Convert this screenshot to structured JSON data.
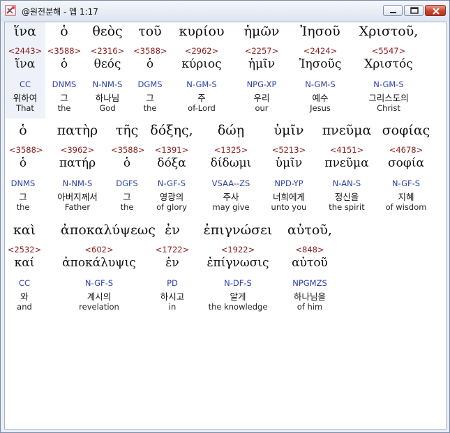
{
  "window": {
    "title": "@원전분해 - 엡 1:17"
  },
  "rows": [
    {
      "words": [
        {
          "greek": "ἵνα",
          "strong": "<2443>",
          "lemma": "ἵνα",
          "parse": "CC",
          "korean": "위하여",
          "english": "That"
        },
        {
          "greek": "ὁ",
          "strong": "<3588>",
          "lemma": "ὁ",
          "parse": "DNMS",
          "korean": "그",
          "english": "the"
        },
        {
          "greek": "θεὸς",
          "strong": "<2316>",
          "lemma": "θεός",
          "parse": "N-NM-S",
          "korean": "하나님",
          "english": "God"
        },
        {
          "greek": "τοῦ",
          "strong": "<3588>",
          "lemma": "ὁ",
          "parse": "DGMS",
          "korean": "그",
          "english": "the"
        },
        {
          "greek": "κυρίου",
          "strong": "<2962>",
          "lemma": "κύριος",
          "parse": "N-GM-S",
          "korean": "주",
          "english": "of-Lord"
        },
        {
          "greek": "ἡμῶν",
          "strong": "<2257>",
          "lemma": "ἡμῖν",
          "parse": "NPG-XP",
          "korean": "우리",
          "english": "our"
        },
        {
          "greek": "Ἰησοῦ",
          "strong": "<2424>",
          "lemma": "Ἰησοῦς",
          "parse": "N-GM-S",
          "korean": "예수",
          "english": "Jesus"
        },
        {
          "greek": "Χριστοῦ,",
          "strong": "<5547>",
          "lemma": "Χριστός",
          "parse": "N-GM-S",
          "korean": "그리스도의",
          "english": "Christ"
        }
      ]
    },
    {
      "words": [
        {
          "greek": "ὁ",
          "strong": "<3588>",
          "lemma": "ὁ",
          "parse": "DNMS",
          "korean": "그",
          "english": "the"
        },
        {
          "greek": "πατὴρ",
          "strong": "<3962>",
          "lemma": "πατήρ",
          "parse": "N-NM-S",
          "korean": "아버지께서",
          "english": "Father"
        },
        {
          "greek": "τῆς",
          "strong": "<3588>",
          "lemma": "ὁ",
          "parse": "DGFS",
          "korean": "그",
          "english": "the"
        },
        {
          "greek": "δόξης,",
          "strong": "<1391>",
          "lemma": "δόξα",
          "parse": "N-GF-S",
          "korean": "영광의",
          "english": "of glory"
        },
        {
          "greek": "δώῃ",
          "strong": "<1325>",
          "lemma": "δίδωμι",
          "parse": "VSAA--ZS",
          "korean": "주사",
          "english": "may give"
        },
        {
          "greek": "ὑμῖν",
          "strong": "<5213>",
          "lemma": "ὑμῖν",
          "parse": "NPD-YP",
          "korean": "너희에게",
          "english": "unto you"
        },
        {
          "greek": "πνεῦμα",
          "strong": "<4151>",
          "lemma": "πνεῦμα",
          "parse": "N-AN-S",
          "korean": "정신을",
          "english": "the spirit"
        },
        {
          "greek": "σοφίας",
          "strong": "<4678>",
          "lemma": "σοφία",
          "parse": "N-GF-S",
          "korean": "지혜",
          "english": "of wisdom"
        }
      ]
    },
    {
      "words": [
        {
          "greek": "καὶ",
          "strong": "<2532>",
          "lemma": "καί",
          "parse": "CC",
          "korean": "와",
          "english": "and"
        },
        {
          "greek": "ἀποκαλύψεως",
          "strong": "<602>",
          "lemma": "ἀποκάλυψις",
          "parse": "N-GF-S",
          "korean": "계시의",
          "english": "revelation"
        },
        {
          "greek": "ἐν",
          "strong": "<1722>",
          "lemma": "ἐν",
          "parse": "PD",
          "korean": "하시고",
          "english": "in"
        },
        {
          "greek": "ἐπιγνώσει",
          "strong": "<1922>",
          "lemma": "ἐπίγνωσις",
          "parse": "N-DF-S",
          "korean": "알게",
          "english": "the knowledge"
        },
        {
          "greek": "αὐτοῦ,",
          "strong": "<848>",
          "lemma": "αὐτοῦ",
          "parse": "NPGMZS",
          "korean": "하나님을",
          "english": "of him"
        }
      ]
    }
  ]
}
